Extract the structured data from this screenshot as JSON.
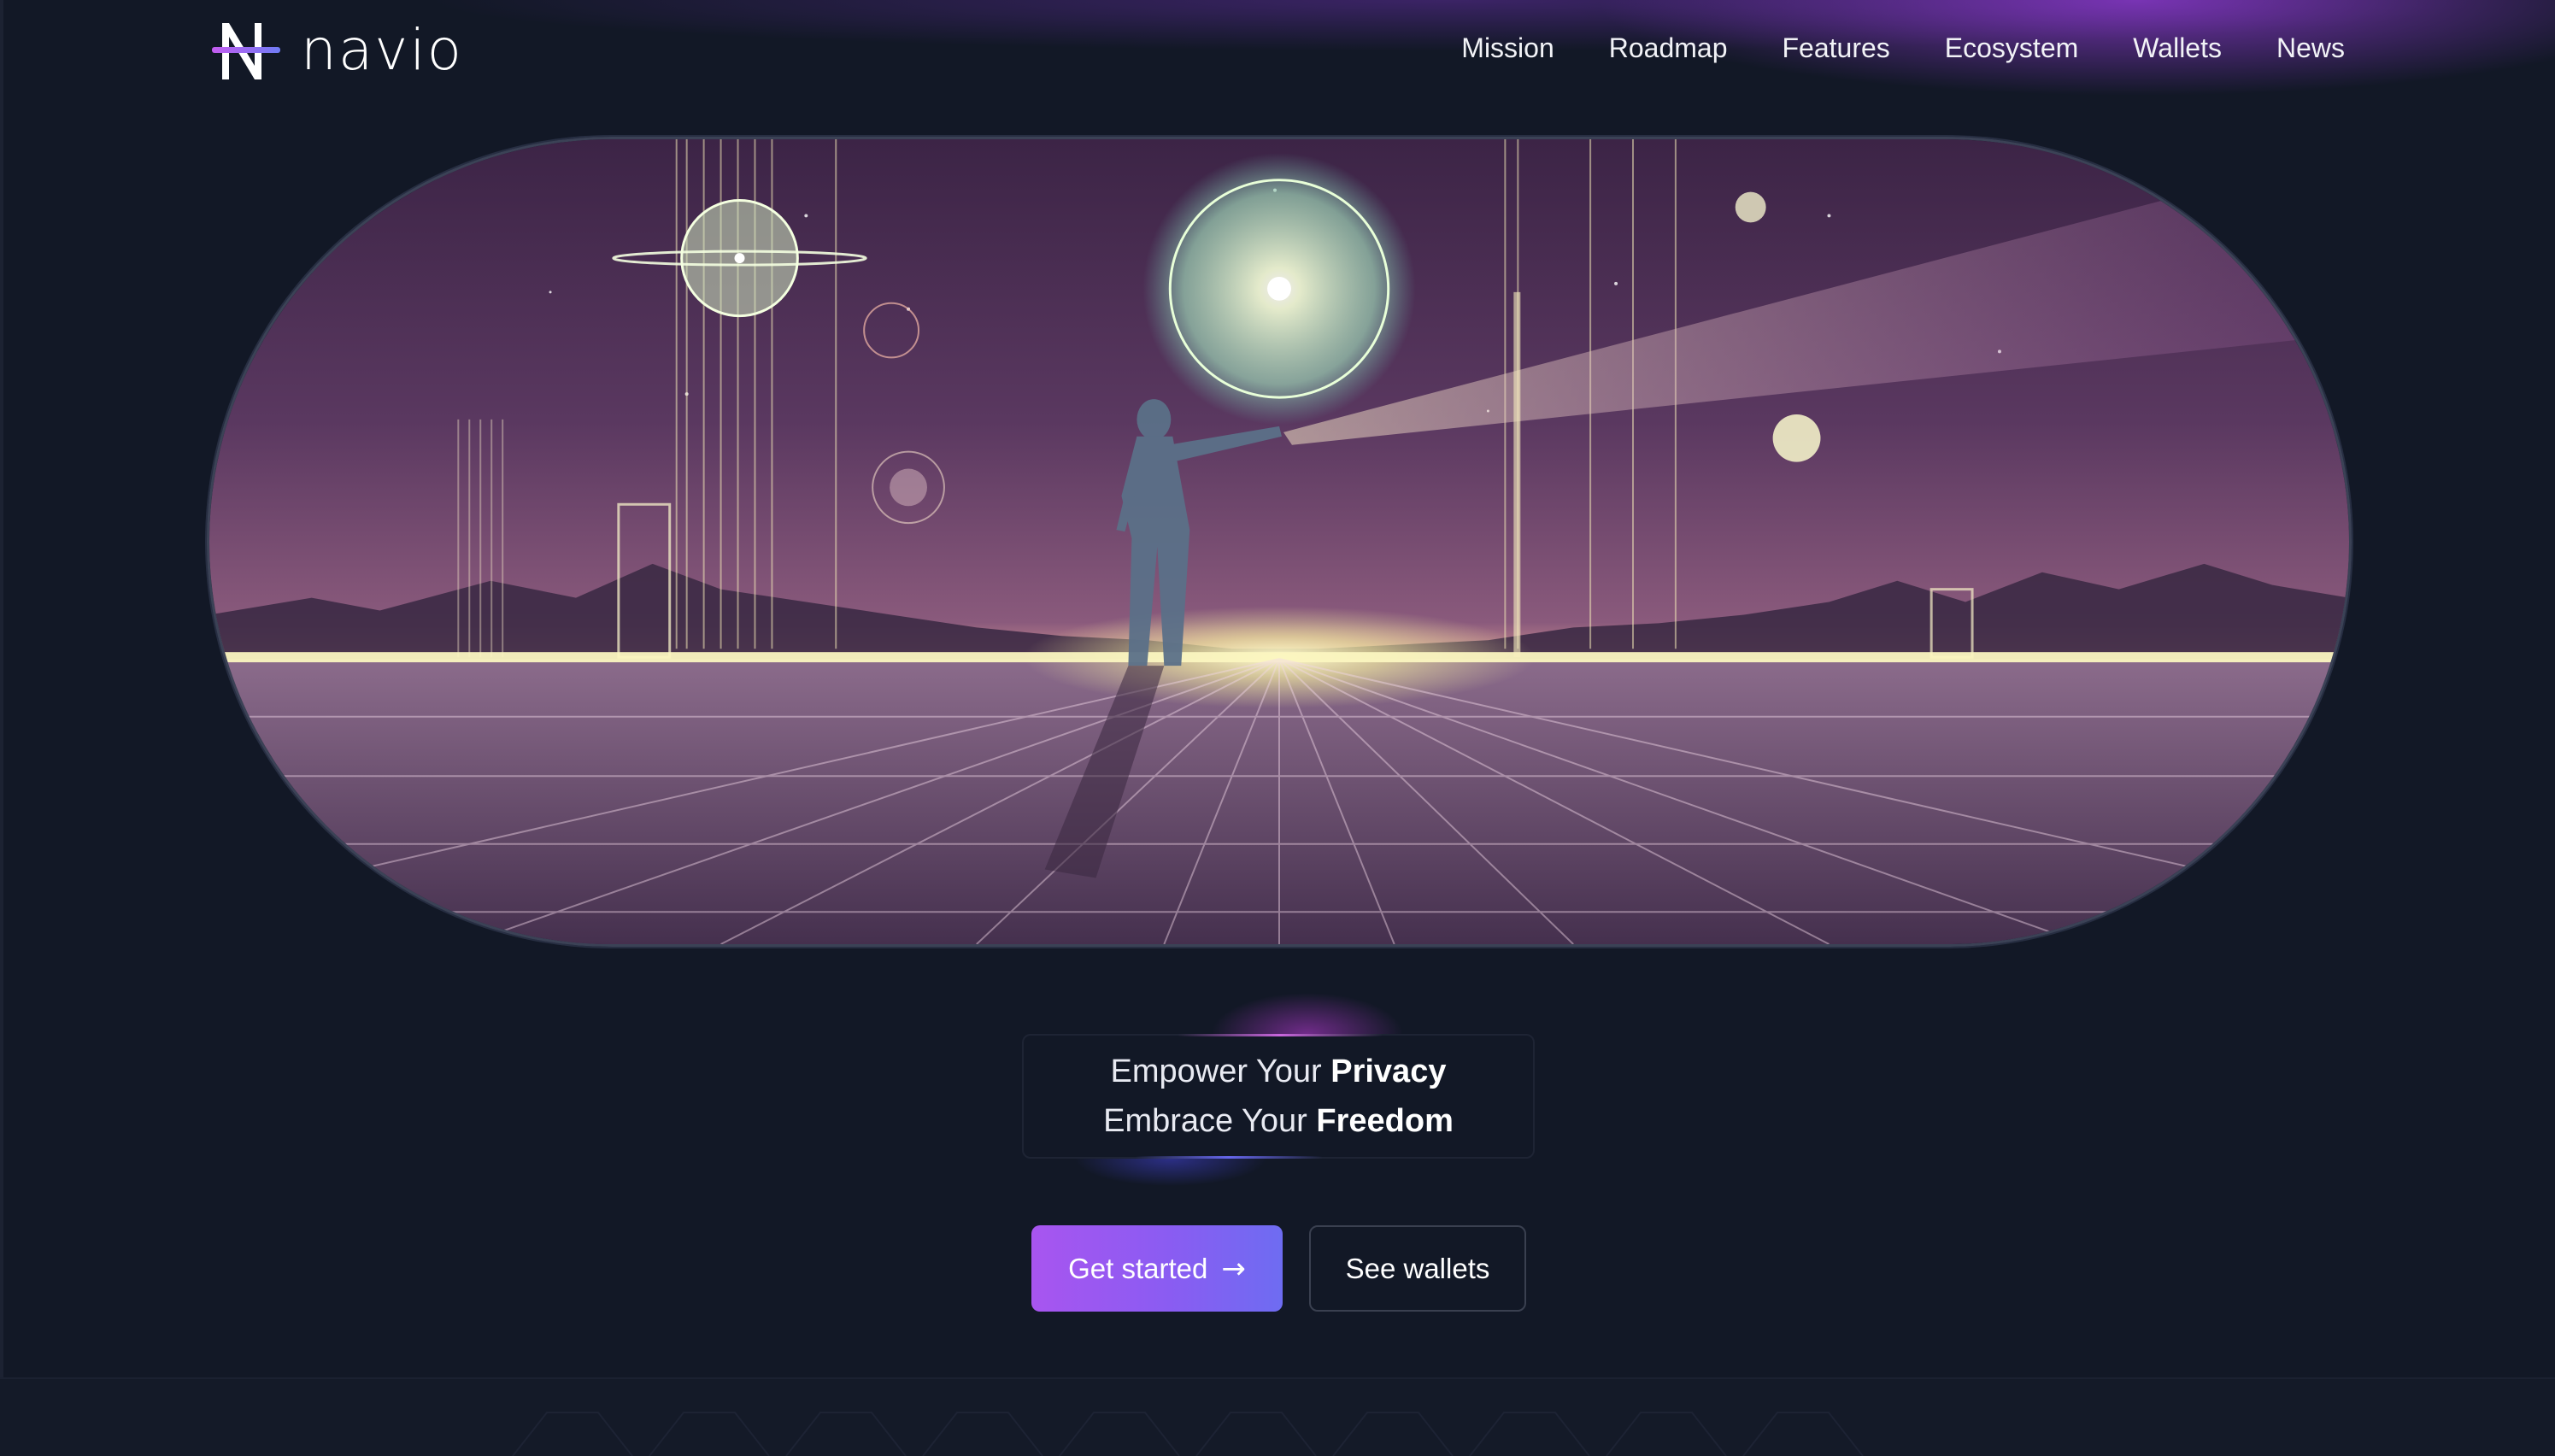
{
  "brand": {
    "name": "navio",
    "logo_icon": "navio-n-icon"
  },
  "nav": {
    "items": [
      {
        "label": "Mission"
      },
      {
        "label": "Roadmap"
      },
      {
        "label": "Features"
      },
      {
        "label": "Ecosystem"
      },
      {
        "label": "Wallets"
      },
      {
        "label": "News"
      }
    ]
  },
  "hero": {
    "tagline": {
      "line1_prefix": "Empower Your ",
      "line1_emphasis": "Privacy",
      "line2_prefix": "Embrace Your ",
      "line2_emphasis": "Freedom"
    }
  },
  "actions": {
    "primary_label": "Get started",
    "primary_icon": "arrow-right-icon",
    "secondary_label": "See wallets"
  },
  "colors": {
    "background": "#121826",
    "accent_start": "#a855f0",
    "accent_end": "#6e6cf2",
    "horizon_glow": "#f6f3b0"
  }
}
